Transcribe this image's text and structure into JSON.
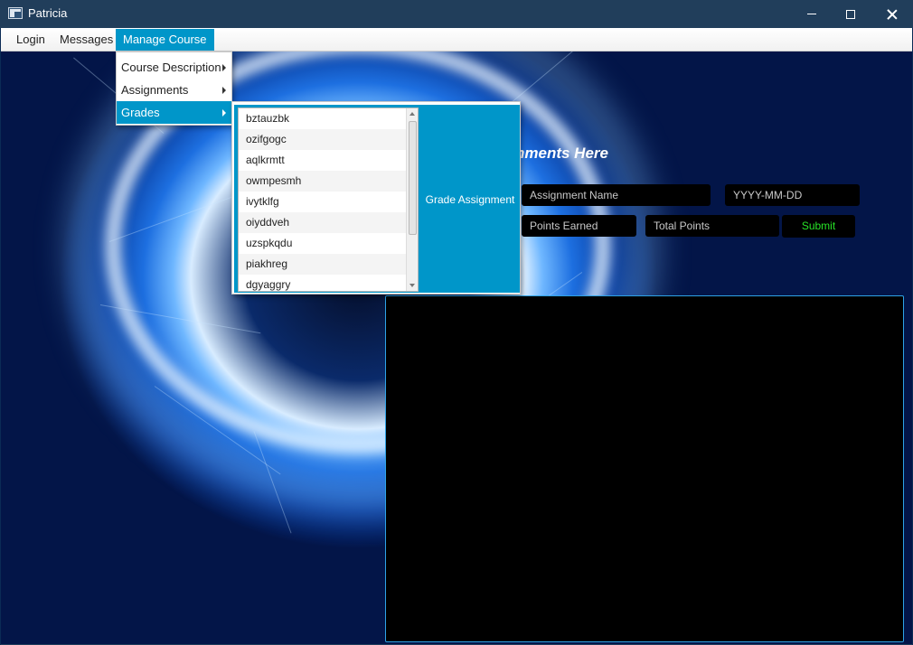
{
  "window": {
    "title": "Patricia",
    "icon": "app-window-icon",
    "controls": [
      "minimize-icon",
      "maximize-icon",
      "close-icon"
    ]
  },
  "menubar": {
    "items": [
      {
        "label": "Login"
      },
      {
        "label": "Messages"
      },
      {
        "label": "Manage Course"
      }
    ]
  },
  "dropdown": {
    "items": [
      {
        "label": "Course Description"
      },
      {
        "label": "Assignments"
      },
      {
        "label": "Grades"
      }
    ]
  },
  "submenu": {
    "students": [
      "bztauzbk",
      "ozifgogc",
      "aqlkrmtt",
      "owmpesmh",
      "ivytklfg",
      "oiyddveh",
      "uzspkqdu",
      "piakhreg",
      "dgyaggry"
    ],
    "grade_button_label": "Grade Assignment"
  },
  "form": {
    "heading": "nments Here",
    "assignment_name_placeholder": "Assignment Name",
    "date_placeholder": "YYYY-MM-DD",
    "points_earned_placeholder": "Points Earned",
    "total_points_placeholder": "Total Points",
    "submit_label": "Submit"
  },
  "colors": {
    "accent": "#0096c9",
    "titlebar": "#213e5b",
    "submit_text": "#27e327",
    "output_border": "#2ea3e6"
  }
}
